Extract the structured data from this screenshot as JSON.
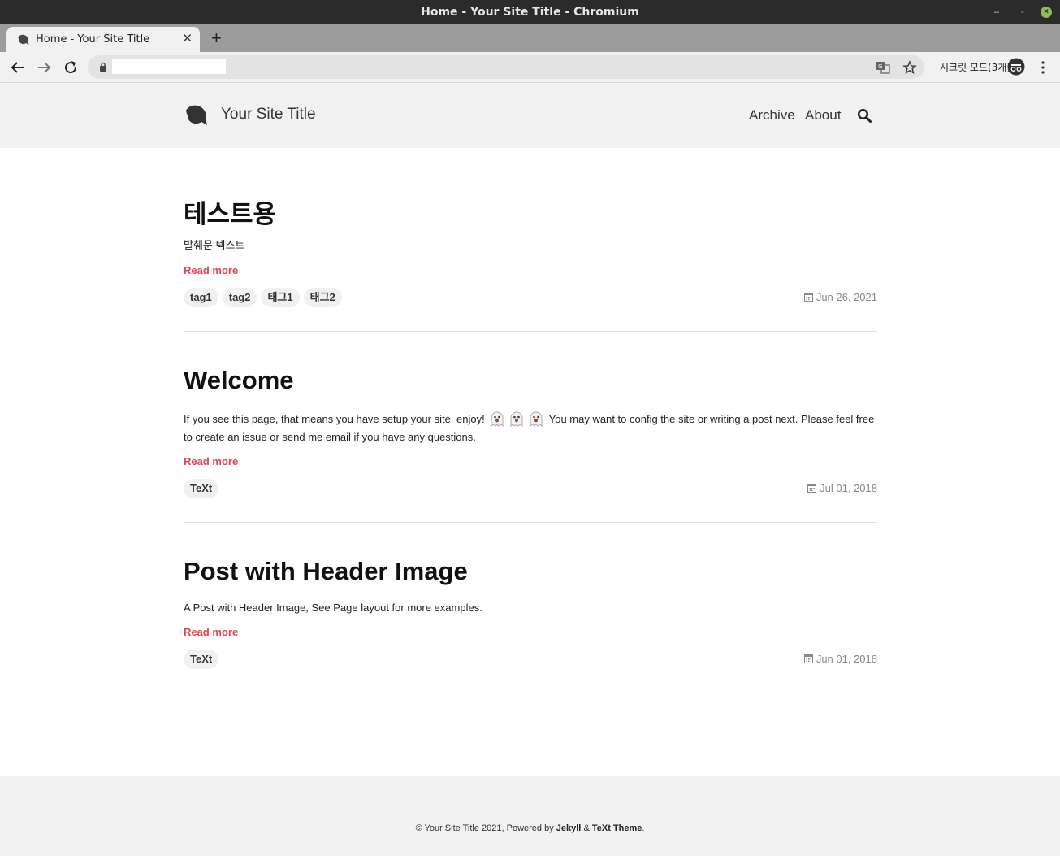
{
  "window": {
    "title": "Home - Your Site Title - Chromium"
  },
  "browser": {
    "tab_title": "Home - Your Site Title",
    "new_tab_label": "+",
    "incognito_label": "시크릿 모드(3개)",
    "icons": [
      "back-arrow-icon",
      "forward-arrow-icon",
      "reload-icon",
      "lock-icon",
      "translate-icon",
      "star-icon",
      "incognito-icon",
      "kebab-menu-icon"
    ]
  },
  "site": {
    "title": "Your Site Title",
    "nav": [
      "Archive",
      "About"
    ],
    "logo": "ginkgo-leaf-logo",
    "accent_color": "#e0434e"
  },
  "posts": [
    {
      "title": "테스트용",
      "excerpt": "발췌문 텍스트",
      "read_more": "Read more",
      "tags": [
        "tag1",
        "tag2",
        "태그1",
        "태그2"
      ],
      "date": "Jun 26, 2021"
    },
    {
      "title": "Welcome",
      "excerpt_part1": "If you see this page, that means you have setup your site. enjoy!",
      "excerpt_part2": "You may want to config the site or writing a post next. Please feel free to create an issue or send me email if you have any questions.",
      "read_more": "Read more",
      "tags": [
        "TeXt"
      ],
      "date": "Jul 01, 2018"
    },
    {
      "title": "Post with Header Image",
      "excerpt": "A Post with Header Image, See Page layout for more examples.",
      "read_more": "Read more",
      "tags": [
        "TeXt"
      ],
      "date": "Jun 01, 2018"
    }
  ],
  "footer": {
    "prefix": "© Your Site Title 2021, Powered by",
    "jekyll": "Jekyll",
    "amp": "&",
    "theme": "TeXt Theme",
    "suffix": "."
  }
}
